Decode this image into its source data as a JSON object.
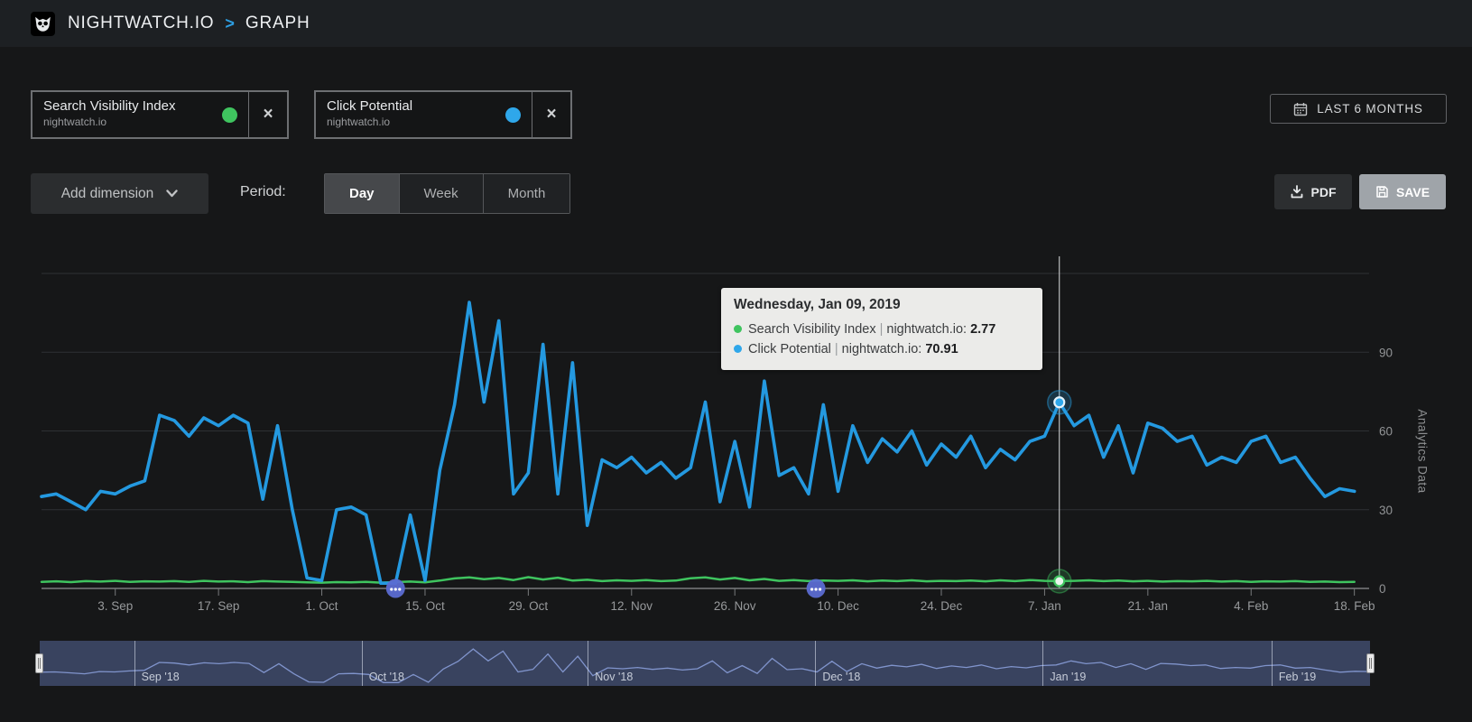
{
  "topbar": {
    "brand": "NIGHTWATCH.IO",
    "separator": ">",
    "page": "GRAPH"
  },
  "metric_cards": [
    {
      "title": "Search Visibility Index",
      "subtitle": "nightwatch.io",
      "color": "#3fc45f",
      "close_label": "×"
    },
    {
      "title": "Click Potential",
      "subtitle": "nightwatch.io",
      "color": "#2fa7ea",
      "close_label": "×"
    }
  ],
  "date_range_button": {
    "label": "LAST 6 MONTHS"
  },
  "controls": {
    "add_dimension_label": "Add dimension",
    "period_label": "Period:",
    "period_options": [
      {
        "label": "Day",
        "active": true
      },
      {
        "label": "Week",
        "active": false
      },
      {
        "label": "Month",
        "active": false
      }
    ],
    "pdf_label": "PDF",
    "save_label": "SAVE"
  },
  "tooltip": {
    "title": "Wednesday, Jan 09, 2019",
    "rows": [
      {
        "metric": "Search Visibility Index",
        "source": "nightwatch.io",
        "value": "2.77",
        "color": "#3fc45f"
      },
      {
        "metric": "Click Potential",
        "source": "nightwatch.io",
        "value": "70.91",
        "color": "#2fa7ea"
      }
    ]
  },
  "chart_data": {
    "type": "line",
    "ylabel": "Analytics Data",
    "ylim": [
      0,
      120
    ],
    "y_ticks": [
      0,
      30,
      60,
      90
    ],
    "grid_values": [
      30,
      60,
      90,
      120
    ],
    "total_days": 180,
    "sample_interval_days": 2,
    "x_tick_labels": [
      "3. Sep",
      "17. Sep",
      "1. Oct",
      "15. Oct",
      "29. Oct",
      "12. Nov",
      "26. Nov",
      "10. Dec",
      "24. Dec",
      "7. Jan",
      "21. Jan",
      "4. Feb",
      "18. Feb"
    ],
    "x_tick_days": [
      10,
      24,
      38,
      52,
      66,
      80,
      94,
      108,
      122,
      136,
      150,
      164,
      178
    ],
    "series": [
      {
        "name": "Click Potential",
        "source": "nightwatch.io",
        "color": "#2499e0",
        "values": [
          35,
          36,
          33,
          30,
          37,
          36,
          39,
          41,
          66,
          64,
          58,
          65,
          62,
          66,
          63,
          34,
          62,
          30,
          4,
          3,
          30,
          31,
          28,
          2,
          2,
          28,
          3,
          45,
          70,
          109,
          71,
          102,
          36,
          44,
          93,
          36,
          86,
          24,
          49,
          46,
          50,
          44,
          48,
          42,
          46,
          71,
          33,
          56,
          31,
          79,
          43,
          46,
          36,
          70,
          37,
          62,
          48,
          57,
          52,
          60,
          47,
          55,
          50,
          58,
          46,
          53,
          49,
          56,
          58,
          70.91,
          62,
          66,
          50,
          62,
          44,
          63,
          61,
          56,
          58,
          47,
          50,
          48,
          56,
          58,
          48,
          50,
          42,
          35,
          38,
          37
        ]
      },
      {
        "name": "Search Visibility Index",
        "source": "nightwatch.io",
        "color": "#3fc45f",
        "values": [
          2.5,
          2.7,
          2.4,
          2.8,
          2.6,
          2.9,
          2.5,
          2.7,
          2.6,
          2.8,
          2.5,
          2.9,
          2.6,
          2.7,
          2.4,
          2.8,
          2.6,
          2.5,
          2.3,
          2.2,
          2.4,
          2.3,
          2.5,
          2.2,
          2.4,
          2.6,
          2.3,
          3.0,
          3.8,
          4.2,
          3.5,
          4.0,
          3.2,
          4.3,
          3.4,
          4.1,
          3.0,
          3.3,
          2.8,
          3.1,
          2.9,
          3.2,
          2.8,
          3.0,
          3.9,
          4.2,
          3.4,
          4.0,
          3.1,
          3.6,
          2.9,
          3.2,
          2.8,
          3.0,
          2.9,
          3.1,
          2.7,
          3.0,
          2.8,
          3.1,
          2.7,
          2.9,
          2.8,
          3.0,
          2.7,
          3.1,
          2.8,
          3.2,
          2.9,
          2.77,
          2.9,
          3.1,
          2.8,
          3.0,
          2.7,
          2.9,
          2.6,
          2.8,
          2.7,
          2.9,
          2.6,
          2.8,
          2.5,
          2.7,
          2.6,
          2.8,
          2.5,
          2.6,
          2.4,
          2.5
        ]
      }
    ],
    "highlight": {
      "day": 138,
      "date_label": "Wednesday, Jan 09, 2019",
      "click_potential": 70.91,
      "search_visibility_index": 2.77
    },
    "note_markers": [
      {
        "day": 48,
        "glyph": "..."
      },
      {
        "day": 105,
        "glyph": "..."
      }
    ]
  },
  "navigator": {
    "months": [
      {
        "label": "Sep '18",
        "frac": 0.071
      },
      {
        "label": "Oct '18",
        "frac": 0.242
      },
      {
        "label": "Nov '18",
        "frac": 0.412
      },
      {
        "label": "Dec '18",
        "frac": 0.583
      },
      {
        "label": "Jan '19",
        "frac": 0.754
      },
      {
        "label": "Feb '19",
        "frac": 0.926
      }
    ]
  }
}
